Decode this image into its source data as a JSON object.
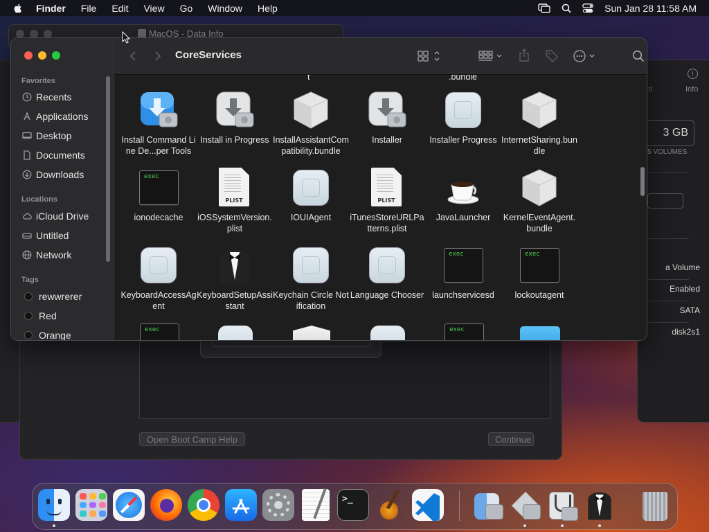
{
  "menubar": {
    "app_name": "Finder",
    "menus": [
      "File",
      "Edit",
      "View",
      "Go",
      "Window",
      "Help"
    ],
    "clock": "Sun Jan 28  11:58 AM",
    "status_icons": [
      "screen-mirroring-icon",
      "spotlight-icon",
      "control-center-icon"
    ]
  },
  "background_windows": {
    "disk_utility_tab_title": "MacOS - Data Info",
    "disk_panel": {
      "info_label": "Info",
      "partial_tab_label": "nt",
      "capacity": "3 GB",
      "volumes_caption": "5 VOLUMES",
      "rows": [
        "a Volume",
        "Enabled",
        "SATA",
        "disk2s1"
      ]
    },
    "bootcamp": {
      "help_button": "Open Boot Camp Help",
      "continue_button": "Continue"
    }
  },
  "finder": {
    "title": "CoreServices",
    "sidebar": {
      "favorites_header": "Favorites",
      "favorites": [
        {
          "label": "Recents",
          "icon": "clock-icon"
        },
        {
          "label": "Applications",
          "icon": "applications-icon"
        },
        {
          "label": "Desktop",
          "icon": "desktop-icon"
        },
        {
          "label": "Documents",
          "icon": "document-icon"
        },
        {
          "label": "Downloads",
          "icon": "download-icon"
        }
      ],
      "locations_header": "Locations",
      "locations": [
        {
          "label": "iCloud Drive",
          "icon": "cloud-icon"
        },
        {
          "label": "Untitled",
          "icon": "drive-icon"
        },
        {
          "label": "Network",
          "icon": "globe-icon"
        }
      ],
      "tags_header": "Tags",
      "tags": [
        "rewwrerer",
        "Red",
        "Orange"
      ]
    },
    "partial_top_labels": [
      "t",
      ".bundle"
    ],
    "rows": [
      [
        {
          "label": "Install Command Line De...per Tools",
          "icon": "installer-blue"
        },
        {
          "label": "Install in Progress",
          "icon": "installer-gray"
        },
        {
          "label": "InstallAssistantCompatibility.bundle",
          "icon": "bundle"
        },
        {
          "label": "Installer",
          "icon": "installer-gray"
        },
        {
          "label": "Installer Progress",
          "icon": "app-generic"
        },
        {
          "label": "InternetSharing.bundle",
          "icon": "bundle"
        }
      ],
      [
        {
          "label": "ionodecache",
          "icon": "exec"
        },
        {
          "label": "iOSSystemVersion.plist",
          "icon": "plist"
        },
        {
          "label": "IOUIAgent",
          "icon": "app-generic"
        },
        {
          "label": "iTunesStoreURLPatterns.plist",
          "icon": "plist"
        },
        {
          "label": "JavaLauncher",
          "icon": "coffee"
        },
        {
          "label": "KernelEventAgent.bundle",
          "icon": "bundle"
        }
      ],
      [
        {
          "label": "KeyboardAccessAgent",
          "icon": "app-generic"
        },
        {
          "label": "KeyboardSetupAssistant",
          "icon": "tuxedo"
        },
        {
          "label": "Keychain Circle Notification",
          "icon": "app-generic"
        },
        {
          "label": "Language Chooser",
          "icon": "app-generic"
        },
        {
          "label": "launchservicesd",
          "icon": "exec"
        },
        {
          "label": "lockoutagent",
          "icon": "exec"
        }
      ]
    ],
    "exec_badge": "exec",
    "plist_badge": "PLIST"
  },
  "dock": {
    "apps": [
      "Finder",
      "Launchpad",
      "Safari",
      "Firefox",
      "Chrome",
      "App Store",
      "System Preferences",
      "TextEdit",
      "Terminal",
      "GarageBand",
      "Visual Studio Code",
      "Migration Assistant",
      "Boot Camp Assistant",
      "Disk Utility",
      "Keyboard Setup Assistant",
      "Trash"
    ]
  }
}
